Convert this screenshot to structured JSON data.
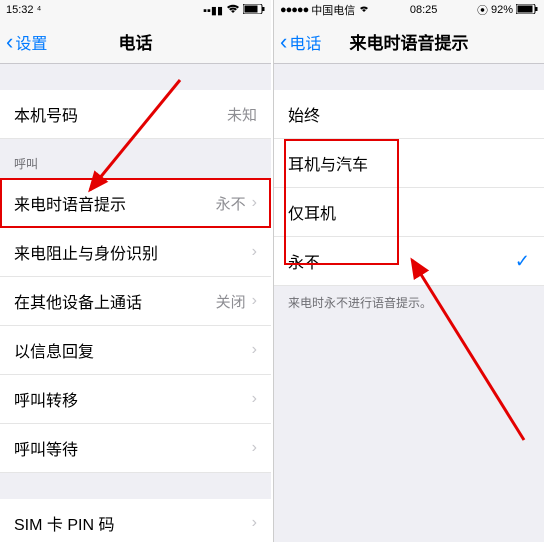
{
  "left": {
    "status": {
      "time": "15:32 ⁴",
      "signal": "▪▪▮▮",
      "wifi": "◉",
      "battery": "▭"
    },
    "nav": {
      "back": "设置",
      "title": "电话"
    },
    "rows": {
      "myNumber": {
        "label": "本机号码",
        "value": "未知"
      },
      "callsHeader": "呼叫",
      "announce": {
        "label": "来电时语音提示",
        "value": "永不"
      },
      "blocking": {
        "label": "来电阻止与身份识别"
      },
      "otherDevices": {
        "label": "在其他设备上通话",
        "value": "关闭"
      },
      "textReply": {
        "label": "以信息回复"
      },
      "forwarding": {
        "label": "呼叫转移"
      },
      "waiting": {
        "label": "呼叫等待"
      },
      "simPin": {
        "label": "SIM 卡 PIN 码"
      }
    }
  },
  "right": {
    "status": {
      "carrier": "••••• 中国电信",
      "time": "08:25",
      "battery": "92%"
    },
    "nav": {
      "back": "电话",
      "title": "来电时语音提示"
    },
    "header": "始终",
    "options": {
      "headphones": "耳机与汽车",
      "onlyHeadphones": "仅耳机",
      "never": "永不"
    },
    "footer": "来电时永不进行语音提示。"
  }
}
